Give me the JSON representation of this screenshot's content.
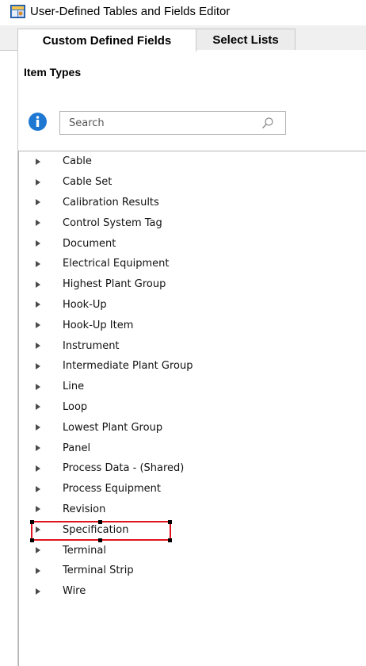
{
  "window": {
    "title": "User-Defined Tables and Fields Editor"
  },
  "tabs": [
    {
      "label": "Custom Defined Fields",
      "active": true
    },
    {
      "label": "Select Lists",
      "active": false
    }
  ],
  "section": {
    "label": "Item Types"
  },
  "search": {
    "placeholder": "Search",
    "value": ""
  },
  "colors": {
    "info_icon": "#1e78d2",
    "highlight": "#e0141e",
    "tab_bg": "#f0f0f0"
  },
  "icons": {
    "info": "info-icon",
    "search": "search-icon",
    "expander": "triangle-right-icon",
    "app": "app-icon"
  },
  "item_types": [
    "Cable",
    "Cable Set",
    "Calibration Results",
    "Control System Tag",
    "Document",
    "Electrical Equipment",
    "Highest Plant Group",
    "Hook-Up",
    "Hook-Up Item",
    "Instrument",
    "Intermediate Plant Group",
    "Line",
    "Loop",
    "Lowest Plant Group",
    "Panel",
    "Process Data - (Shared)",
    "Process Equipment",
    "Revision",
    "Specification",
    "Terminal",
    "Terminal Strip",
    "Wire"
  ],
  "highlighted_item": "Specification"
}
